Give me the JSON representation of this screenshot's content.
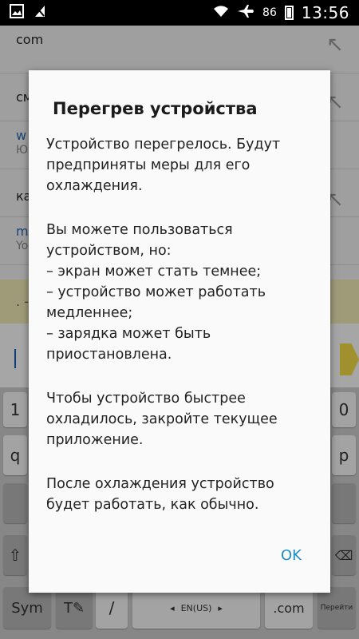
{
  "status_bar": {
    "battery": "86",
    "time": "13:56",
    "icons": [
      "image-icon",
      "signal-off-icon",
      "wifi-icon",
      "airplane-icon",
      "battery-icon"
    ]
  },
  "background": {
    "suggestions": [
      {
        "line1": "com",
        "line2": ""
      },
      {
        "line1": "cм",
        "line2": ""
      },
      {
        "line1": "w",
        "line2": "Ю"
      },
      {
        "line1": "ка",
        "line2": ""
      },
      {
        "line1": "m",
        "line2": "Yo"
      }
    ],
    "address_hint": ". -"
  },
  "keyboard": {
    "row1": [
      "1",
      "0"
    ],
    "row2": [
      "q",
      "p"
    ],
    "bottom": {
      "sym": "Sym",
      "slash": "/",
      "lang": "EN(US)",
      "com": ".com",
      "go": "Перейти"
    }
  },
  "dialog": {
    "title": "Перегрев устройства",
    "paragraph1": "Устройство перегрелось. Будут\nпредприняты меры для его\nохлаждения.",
    "paragraph2": "Вы можете пользоваться\nустройством, но:\n– экран может стать темнее;\n– устройство может работать\nмедленнее;\n– зарядка может быть\nприостановлена.",
    "paragraph3": "Чтобы устройство быстрее\nохладилось, закройте текущее\nприложение.",
    "paragraph4": "После охлаждения устройство\nбудет работать, как обычно.",
    "ok_label": "OK"
  },
  "colors": {
    "ok_button": "#1a8ec7",
    "address_bar": "#f5efbb",
    "highlight": "#f7de47"
  }
}
